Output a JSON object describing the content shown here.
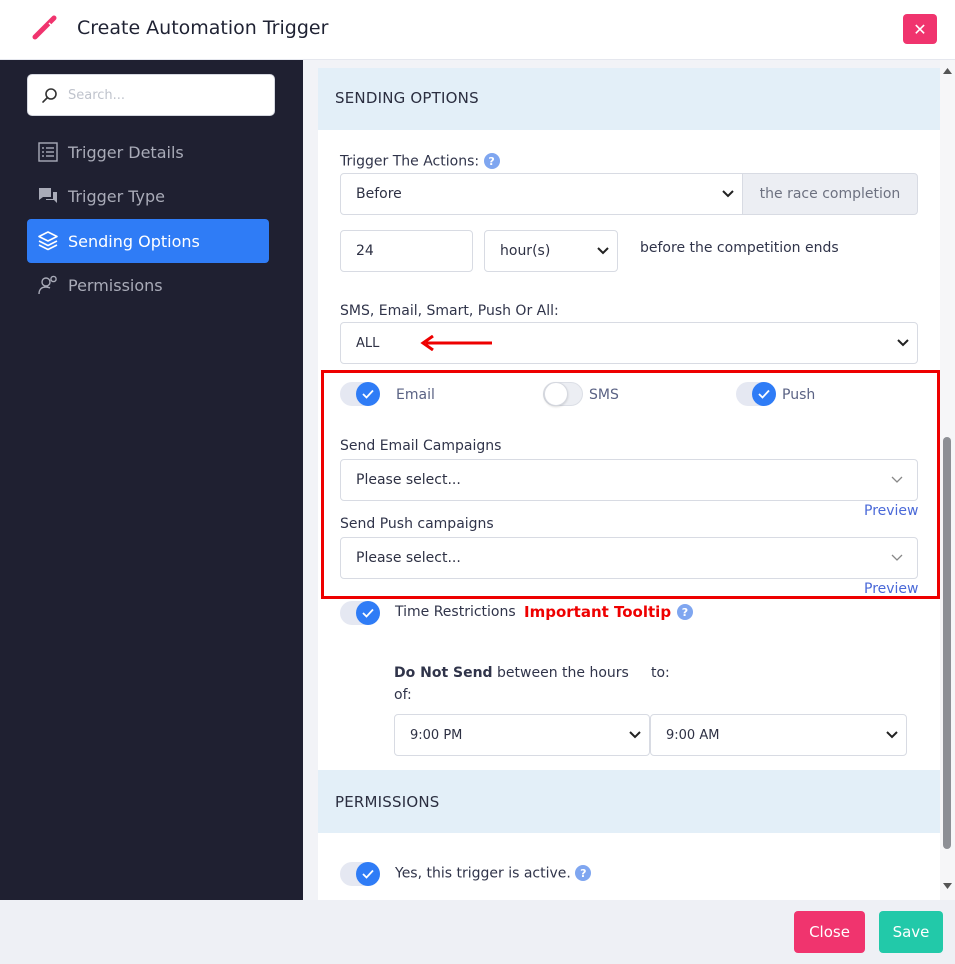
{
  "header": {
    "title": "Create Automation Trigger"
  },
  "sidebar": {
    "search_placeholder": "Search...",
    "items": [
      {
        "label": "Trigger Details"
      },
      {
        "label": "Trigger Type"
      },
      {
        "label": "Sending Options"
      },
      {
        "label": "Permissions"
      }
    ]
  },
  "sending": {
    "heading": "SENDING OPTIONS",
    "trigger_label": "Trigger The Actions:",
    "help": "?",
    "timing_value": "Before",
    "timing_addon": "the race completion",
    "amount_value": "24",
    "unit_value": "hour(s)",
    "amount_suffix": "before the competition ends",
    "channel_label": "SMS, Email, Smart, Push Or All:",
    "channel_value": "ALL",
    "toggles": {
      "email": "Email",
      "sms": "SMS",
      "push": "Push"
    },
    "email_campaigns_label": "Send Email Campaigns",
    "email_campaigns_placeholder": "Please select...",
    "push_campaigns_label": "Send Push campaigns",
    "push_campaigns_placeholder": "Please select...",
    "preview": "Preview",
    "time_restrictions_label": "Time Restrictions",
    "tooltip_note": "Important Tooltip",
    "do_not_send_bold": "Do Not Send",
    "do_not_send_rest": " between the hours",
    "of": "of:",
    "to": "to:",
    "from_time": "9:00 PM",
    "to_time": "9:00 AM"
  },
  "permissions": {
    "heading": "PERMISSIONS",
    "active_label": "Yes, this trigger is active."
  },
  "footer": {
    "close_label": "Close",
    "save_label": "Save"
  },
  "colors": {
    "accent": "#2f7cf6",
    "sidebar": "#1f2031",
    "danger": "#f0346e",
    "save": "#22c9a9",
    "annotation": "#e00000"
  }
}
